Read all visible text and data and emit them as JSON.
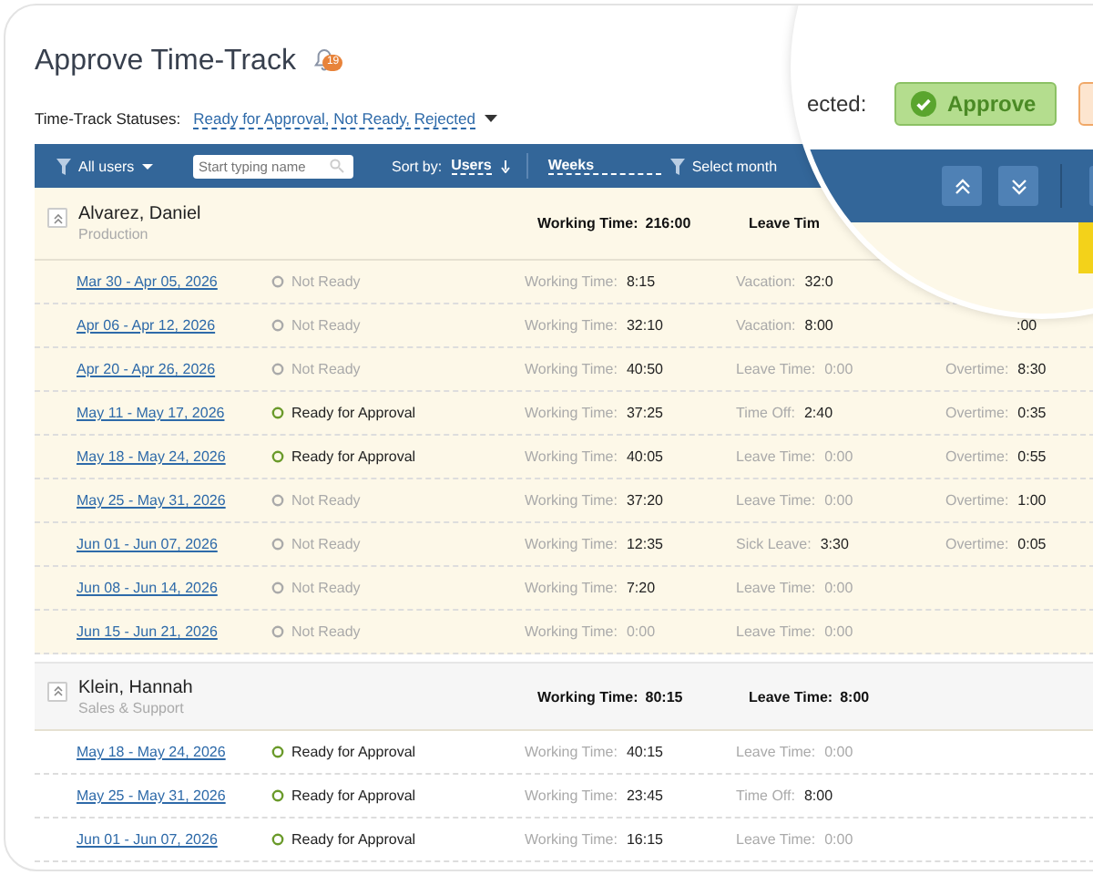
{
  "title": "Approve Time-Track",
  "notifications": "19",
  "statuses": {
    "label": "Time-Track Statuses:",
    "value": "Ready for Approval, Not Ready, Rejected"
  },
  "toolbar": {
    "users": "All users",
    "search_placeholder": "Start typing name",
    "sort_label": "Sort by:",
    "sort_value": "Users",
    "period": "Weeks",
    "month": "Select month"
  },
  "lens": {
    "label": "ected:",
    "approve": "Approve"
  },
  "groups": [
    {
      "name": "Alvarez, Daniel",
      "department": "Production",
      "expanded": true,
      "highlighted": true,
      "summary": [
        {
          "label": "Working Time:",
          "value": "216:00"
        },
        {
          "label": "Leave Tim"
        }
      ],
      "rows": [
        {
          "date": "Mar 30 - Apr 05, 2026",
          "status": "Not Ready",
          "kind": "not_ready",
          "items": [
            {
              "label": "Working Time:",
              "value": "8:15",
              "dim": false
            },
            {
              "label": "Vacation:",
              "value": "32:0",
              "dim": false
            }
          ]
        },
        {
          "date": "Apr 06 - Apr 12, 2026",
          "status": "Not Ready",
          "kind": "not_ready",
          "items": [
            {
              "label": "Working Time:",
              "value": "32:10",
              "dim": false
            },
            {
              "label": "Vacation:",
              "value": "8:00",
              "dim": false
            },
            {
              "value": ":00",
              "dim": false
            }
          ]
        },
        {
          "date": "Apr 20 - Apr 26, 2026",
          "status": "Not Ready",
          "kind": "not_ready",
          "items": [
            {
              "label": "Working Time:",
              "value": "40:50",
              "dim": false
            },
            {
              "label": "Leave Time:",
              "value": "0:00",
              "dim": true
            },
            {
              "label": "Overtime:",
              "value": "8:30",
              "dim": false
            }
          ]
        },
        {
          "date": "May 11 - May 17, 2026",
          "status": "Ready for Approval",
          "kind": "ready",
          "items": [
            {
              "label": "Working Time:",
              "value": "37:25",
              "dim": false
            },
            {
              "label": "Time Off:",
              "value": "2:40",
              "dim": false
            },
            {
              "label": "Overtime:",
              "value": "0:35",
              "dim": false
            }
          ]
        },
        {
          "date": "May 18 - May 24, 2026",
          "status": "Ready for Approval",
          "kind": "ready",
          "items": [
            {
              "label": "Working Time:",
              "value": "40:05",
              "dim": false
            },
            {
              "label": "Leave Time:",
              "value": "0:00",
              "dim": true
            },
            {
              "label": "Overtime:",
              "value": "0:55",
              "dim": false
            }
          ]
        },
        {
          "date": "May 25 - May 31, 2026",
          "status": "Not Ready",
          "kind": "not_ready",
          "items": [
            {
              "label": "Working Time:",
              "value": "37:20",
              "dim": false
            },
            {
              "label": "Leave Time:",
              "value": "0:00",
              "dim": true
            },
            {
              "label": "Overtime:",
              "value": "1:00",
              "dim": false
            }
          ]
        },
        {
          "date": "Jun 01 - Jun 07, 2026",
          "status": "Not Ready",
          "kind": "not_ready",
          "items": [
            {
              "label": "Working Time:",
              "value": "12:35",
              "dim": false
            },
            {
              "label": "Sick Leave:",
              "value": "3:30",
              "dim": false
            },
            {
              "label": "Overtime:",
              "value": "0:05",
              "dim": false
            }
          ]
        },
        {
          "date": "Jun 08 - Jun 14, 2026",
          "status": "Not Ready",
          "kind": "not_ready",
          "items": [
            {
              "label": "Working Time:",
              "value": "7:20",
              "dim": false
            },
            {
              "label": "Leave Time:",
              "value": "0:00",
              "dim": true
            }
          ]
        },
        {
          "date": "Jun 15 - Jun 21, 2026",
          "status": "Not Ready",
          "kind": "not_ready",
          "items": [
            {
              "label": "Working Time:",
              "value": "0:00",
              "dim": true
            },
            {
              "label": "Leave Time:",
              "value": "0:00",
              "dim": true
            }
          ]
        }
      ]
    },
    {
      "name": "Klein, Hannah",
      "department": "Sales & Support",
      "expanded": true,
      "highlighted": false,
      "summary": [
        {
          "label": "Working Time:",
          "value": "80:15"
        },
        {
          "label": "Leave Time:",
          "value": "8:00"
        }
      ],
      "rows": [
        {
          "date": "May 18 - May 24, 2026",
          "status": "Ready for Approval",
          "kind": "ready",
          "items": [
            {
              "label": "Working Time:",
              "value": "40:15",
              "dim": false
            },
            {
              "label": "Leave Time:",
              "value": "0:00",
              "dim": true
            }
          ]
        },
        {
          "date": "May 25 - May 31, 2026",
          "status": "Ready for Approval",
          "kind": "ready",
          "items": [
            {
              "label": "Working Time:",
              "value": "23:45",
              "dim": false
            },
            {
              "label": "Time Off:",
              "value": "8:00",
              "dim": false
            }
          ]
        },
        {
          "date": "Jun 01 - Jun 07, 2026",
          "status": "Ready for Approval",
          "kind": "ready",
          "items": [
            {
              "label": "Working Time:",
              "value": "16:15",
              "dim": false
            },
            {
              "label": "Leave Time:",
              "value": "0:00",
              "dim": true
            }
          ]
        }
      ]
    }
  ]
}
